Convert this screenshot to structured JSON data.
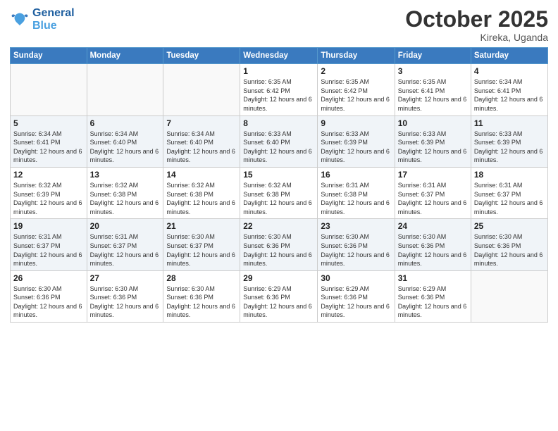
{
  "header": {
    "logo_line1": "General",
    "logo_line2": "Blue",
    "month": "October 2025",
    "location": "Kireka, Uganda"
  },
  "weekdays": [
    "Sunday",
    "Monday",
    "Tuesday",
    "Wednesday",
    "Thursday",
    "Friday",
    "Saturday"
  ],
  "weeks": [
    [
      {
        "day": "",
        "info": ""
      },
      {
        "day": "",
        "info": ""
      },
      {
        "day": "",
        "info": ""
      },
      {
        "day": "1",
        "info": "Sunrise: 6:35 AM\nSunset: 6:42 PM\nDaylight: 12 hours and 6 minutes."
      },
      {
        "day": "2",
        "info": "Sunrise: 6:35 AM\nSunset: 6:42 PM\nDaylight: 12 hours and 6 minutes."
      },
      {
        "day": "3",
        "info": "Sunrise: 6:35 AM\nSunset: 6:41 PM\nDaylight: 12 hours and 6 minutes."
      },
      {
        "day": "4",
        "info": "Sunrise: 6:34 AM\nSunset: 6:41 PM\nDaylight: 12 hours and 6 minutes."
      }
    ],
    [
      {
        "day": "5",
        "info": "Sunrise: 6:34 AM\nSunset: 6:41 PM\nDaylight: 12 hours and 6 minutes."
      },
      {
        "day": "6",
        "info": "Sunrise: 6:34 AM\nSunset: 6:40 PM\nDaylight: 12 hours and 6 minutes."
      },
      {
        "day": "7",
        "info": "Sunrise: 6:34 AM\nSunset: 6:40 PM\nDaylight: 12 hours and 6 minutes."
      },
      {
        "day": "8",
        "info": "Sunrise: 6:33 AM\nSunset: 6:40 PM\nDaylight: 12 hours and 6 minutes."
      },
      {
        "day": "9",
        "info": "Sunrise: 6:33 AM\nSunset: 6:39 PM\nDaylight: 12 hours and 6 minutes."
      },
      {
        "day": "10",
        "info": "Sunrise: 6:33 AM\nSunset: 6:39 PM\nDaylight: 12 hours and 6 minutes."
      },
      {
        "day": "11",
        "info": "Sunrise: 6:33 AM\nSunset: 6:39 PM\nDaylight: 12 hours and 6 minutes."
      }
    ],
    [
      {
        "day": "12",
        "info": "Sunrise: 6:32 AM\nSunset: 6:39 PM\nDaylight: 12 hours and 6 minutes."
      },
      {
        "day": "13",
        "info": "Sunrise: 6:32 AM\nSunset: 6:38 PM\nDaylight: 12 hours and 6 minutes."
      },
      {
        "day": "14",
        "info": "Sunrise: 6:32 AM\nSunset: 6:38 PM\nDaylight: 12 hours and 6 minutes."
      },
      {
        "day": "15",
        "info": "Sunrise: 6:32 AM\nSunset: 6:38 PM\nDaylight: 12 hours and 6 minutes."
      },
      {
        "day": "16",
        "info": "Sunrise: 6:31 AM\nSunset: 6:38 PM\nDaylight: 12 hours and 6 minutes."
      },
      {
        "day": "17",
        "info": "Sunrise: 6:31 AM\nSunset: 6:37 PM\nDaylight: 12 hours and 6 minutes."
      },
      {
        "day": "18",
        "info": "Sunrise: 6:31 AM\nSunset: 6:37 PM\nDaylight: 12 hours and 6 minutes."
      }
    ],
    [
      {
        "day": "19",
        "info": "Sunrise: 6:31 AM\nSunset: 6:37 PM\nDaylight: 12 hours and 6 minutes."
      },
      {
        "day": "20",
        "info": "Sunrise: 6:31 AM\nSunset: 6:37 PM\nDaylight: 12 hours and 6 minutes."
      },
      {
        "day": "21",
        "info": "Sunrise: 6:30 AM\nSunset: 6:37 PM\nDaylight: 12 hours and 6 minutes."
      },
      {
        "day": "22",
        "info": "Sunrise: 6:30 AM\nSunset: 6:36 PM\nDaylight: 12 hours and 6 minutes."
      },
      {
        "day": "23",
        "info": "Sunrise: 6:30 AM\nSunset: 6:36 PM\nDaylight: 12 hours and 6 minutes."
      },
      {
        "day": "24",
        "info": "Sunrise: 6:30 AM\nSunset: 6:36 PM\nDaylight: 12 hours and 6 minutes."
      },
      {
        "day": "25",
        "info": "Sunrise: 6:30 AM\nSunset: 6:36 PM\nDaylight: 12 hours and 6 minutes."
      }
    ],
    [
      {
        "day": "26",
        "info": "Sunrise: 6:30 AM\nSunset: 6:36 PM\nDaylight: 12 hours and 6 minutes."
      },
      {
        "day": "27",
        "info": "Sunrise: 6:30 AM\nSunset: 6:36 PM\nDaylight: 12 hours and 6 minutes."
      },
      {
        "day": "28",
        "info": "Sunrise: 6:30 AM\nSunset: 6:36 PM\nDaylight: 12 hours and 6 minutes."
      },
      {
        "day": "29",
        "info": "Sunrise: 6:29 AM\nSunset: 6:36 PM\nDaylight: 12 hours and 6 minutes."
      },
      {
        "day": "30",
        "info": "Sunrise: 6:29 AM\nSunset: 6:36 PM\nDaylight: 12 hours and 6 minutes."
      },
      {
        "day": "31",
        "info": "Sunrise: 6:29 AM\nSunset: 6:36 PM\nDaylight: 12 hours and 6 minutes."
      },
      {
        "day": "",
        "info": ""
      }
    ]
  ]
}
